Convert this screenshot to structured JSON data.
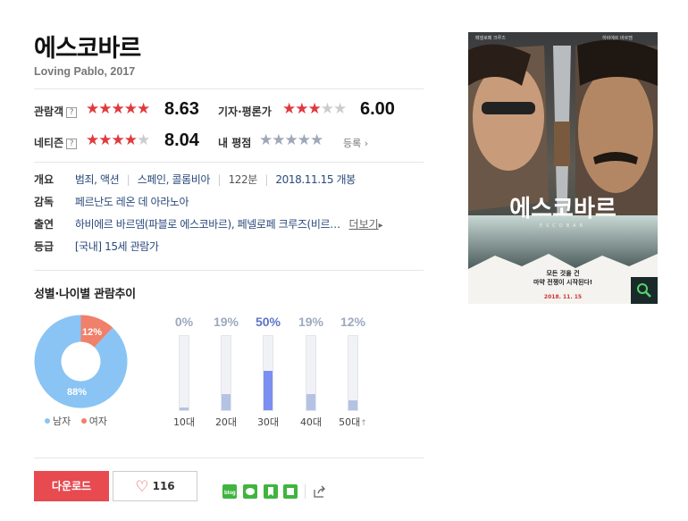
{
  "movie": {
    "title": "에스코바르",
    "subtitle": "Loving Pablo, 2017"
  },
  "scores": {
    "audience": {
      "label": "관람객",
      "rating": 8.63,
      "stars": 4.5,
      "value": "8.63"
    },
    "critics": {
      "label": "기자·평론가",
      "rating": 6.0,
      "stars": 3,
      "value": "6.00"
    },
    "netizen": {
      "label": "네티즌",
      "rating": 8.04,
      "stars": 4,
      "value": "8.04"
    },
    "my_rating": {
      "label": "내 평점",
      "stars": 0,
      "register_label": "등록"
    },
    "help_icon": "?"
  },
  "info": {
    "overview": {
      "key": "개요",
      "genres": [
        "범죄",
        "액션"
      ],
      "countries": [
        "스페인",
        "콜롬비아"
      ],
      "runtime": "122분",
      "release": "2018.11.15 개봉"
    },
    "director": {
      "key": "감독",
      "value": "페르난도 레온 데 아라노아"
    },
    "cast": {
      "key": "출연",
      "value": "하비에르 바르뎀(파블로 에스코바르), 페넬로페 크루즈(비르…",
      "more_label": "더보기"
    },
    "grade": {
      "key": "등급",
      "value": "[국내] 15세 관람가"
    }
  },
  "trend": {
    "title": "성별·나이별 관람추이",
    "gender": {
      "male": {
        "label": "남자",
        "pct": 88,
        "text": "88%",
        "color": "#89c4f4"
      },
      "female": {
        "label": "여자",
        "pct": 12,
        "text": "12%",
        "color": "#f0806a"
      }
    },
    "ages": [
      {
        "label": "10대",
        "pct": 0,
        "text": "0%"
      },
      {
        "label": "20대",
        "pct": 19,
        "text": "19%"
      },
      {
        "label": "30대",
        "pct": 50,
        "text": "50%"
      },
      {
        "label": "40대",
        "pct": 19,
        "text": "19%"
      },
      {
        "label": "50대",
        "pct": 12,
        "text": "12%"
      }
    ]
  },
  "actions": {
    "download_label": "다운로드",
    "like_count": "116",
    "share_icons": [
      "blog-icon",
      "talk-icon",
      "bookmark-icon",
      "note-icon",
      "share-icon"
    ]
  },
  "poster": {
    "title": "에스코바르",
    "top_left_text": "페넬로페 크루즈",
    "top_right_text": "하비에르 바르뎀",
    "tagline_1": "모든 것을 건",
    "tagline_2": "마약 전쟁이 시작된다!",
    "date": "2018. 11. 15",
    "sub_title": "ESCOBAR"
  }
}
